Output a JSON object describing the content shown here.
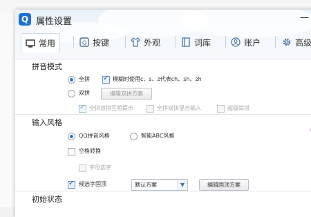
{
  "window": {
    "title": "属性设置",
    "logo_letter": "Q",
    "minimize_glyph": "—"
  },
  "tabs": [
    {
      "label": "常用",
      "icon": "monitor-icon"
    },
    {
      "label": "按键",
      "icon": "keyboard-q-icon"
    },
    {
      "label": "外观",
      "icon": "shirt-icon"
    },
    {
      "label": "词库",
      "icon": "book-icon"
    },
    {
      "label": "账户",
      "icon": "user-icon"
    },
    {
      "label": "高级",
      "icon": "gear-icon"
    }
  ],
  "pinyin_mode": {
    "title": "拼音模式",
    "quanpin_label": "全拼",
    "fuzzy_label": "模糊时使用c、s、z代表ch、sh、zh",
    "shuangpin_label": "双拼",
    "edit_shuangpin_label": "编辑双拼方案",
    "sp_hint_label": "全拼双拼互相提示",
    "sp_mix_label": "全拼双拼混合输入",
    "super_sp_label": "超级简拼"
  },
  "input_style": {
    "title": "输入风格",
    "qq_style_label": "QQ拼音风格",
    "abc_style_label": "智能ABC风格",
    "space_convert_label": "空格转换",
    "letter_select_label": "字母选字",
    "pin_top_label": "候选字固顶",
    "scheme_value": "默认方案",
    "edit_pin_label": "编辑固顶方案"
  },
  "initial_state": {
    "title": "初始状态"
  },
  "colors": {
    "accent": "#1d6fd6",
    "selected": "#2a77d3"
  }
}
